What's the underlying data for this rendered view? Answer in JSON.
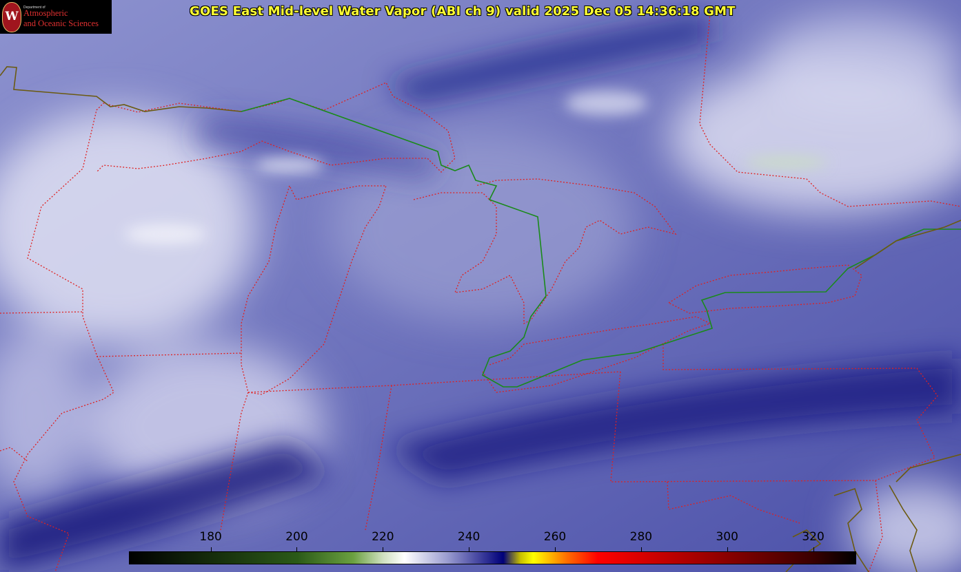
{
  "title": "GOES East Mid-level Water Vapor (ABI ch 9)  valid 2025 Dec 05 14:36:18 GMT",
  "logo": {
    "department": "Department of",
    "line1": "Atmospheric",
    "line2": "and Oceanic Sciences",
    "seal_letter": "W"
  },
  "colorbar": {
    "ticks": [
      "180",
      "200",
      "220",
      "240",
      "260",
      "280",
      "300",
      "320"
    ],
    "tick_values": [
      180,
      200,
      220,
      240,
      260,
      280,
      300,
      320
    ],
    "range": [
      161,
      330
    ],
    "stops": [
      {
        "value": 161,
        "color": "#000000"
      },
      {
        "value": 200,
        "color": "#2b5a18"
      },
      {
        "value": 213,
        "color": "#6aa040"
      },
      {
        "value": 220,
        "color": "#cfe0c0"
      },
      {
        "value": 225,
        "color": "#ffffff"
      },
      {
        "value": 235,
        "color": "#9a9cd0"
      },
      {
        "value": 248,
        "color": "#00007a"
      },
      {
        "value": 252,
        "color": "#c8c000"
      },
      {
        "value": 255,
        "color": "#ffff00"
      },
      {
        "value": 263,
        "color": "#ff6a00"
      },
      {
        "value": 270,
        "color": "#ff0000"
      },
      {
        "value": 300,
        "color": "#8a0000"
      },
      {
        "value": 320,
        "color": "#3a0000"
      },
      {
        "value": 330,
        "color": "#000000"
      }
    ]
  },
  "colors": {
    "state_border": "#e02020",
    "international_border": "#007a1a",
    "coastline": "#6b5a10",
    "title_text": "#ffff33"
  }
}
